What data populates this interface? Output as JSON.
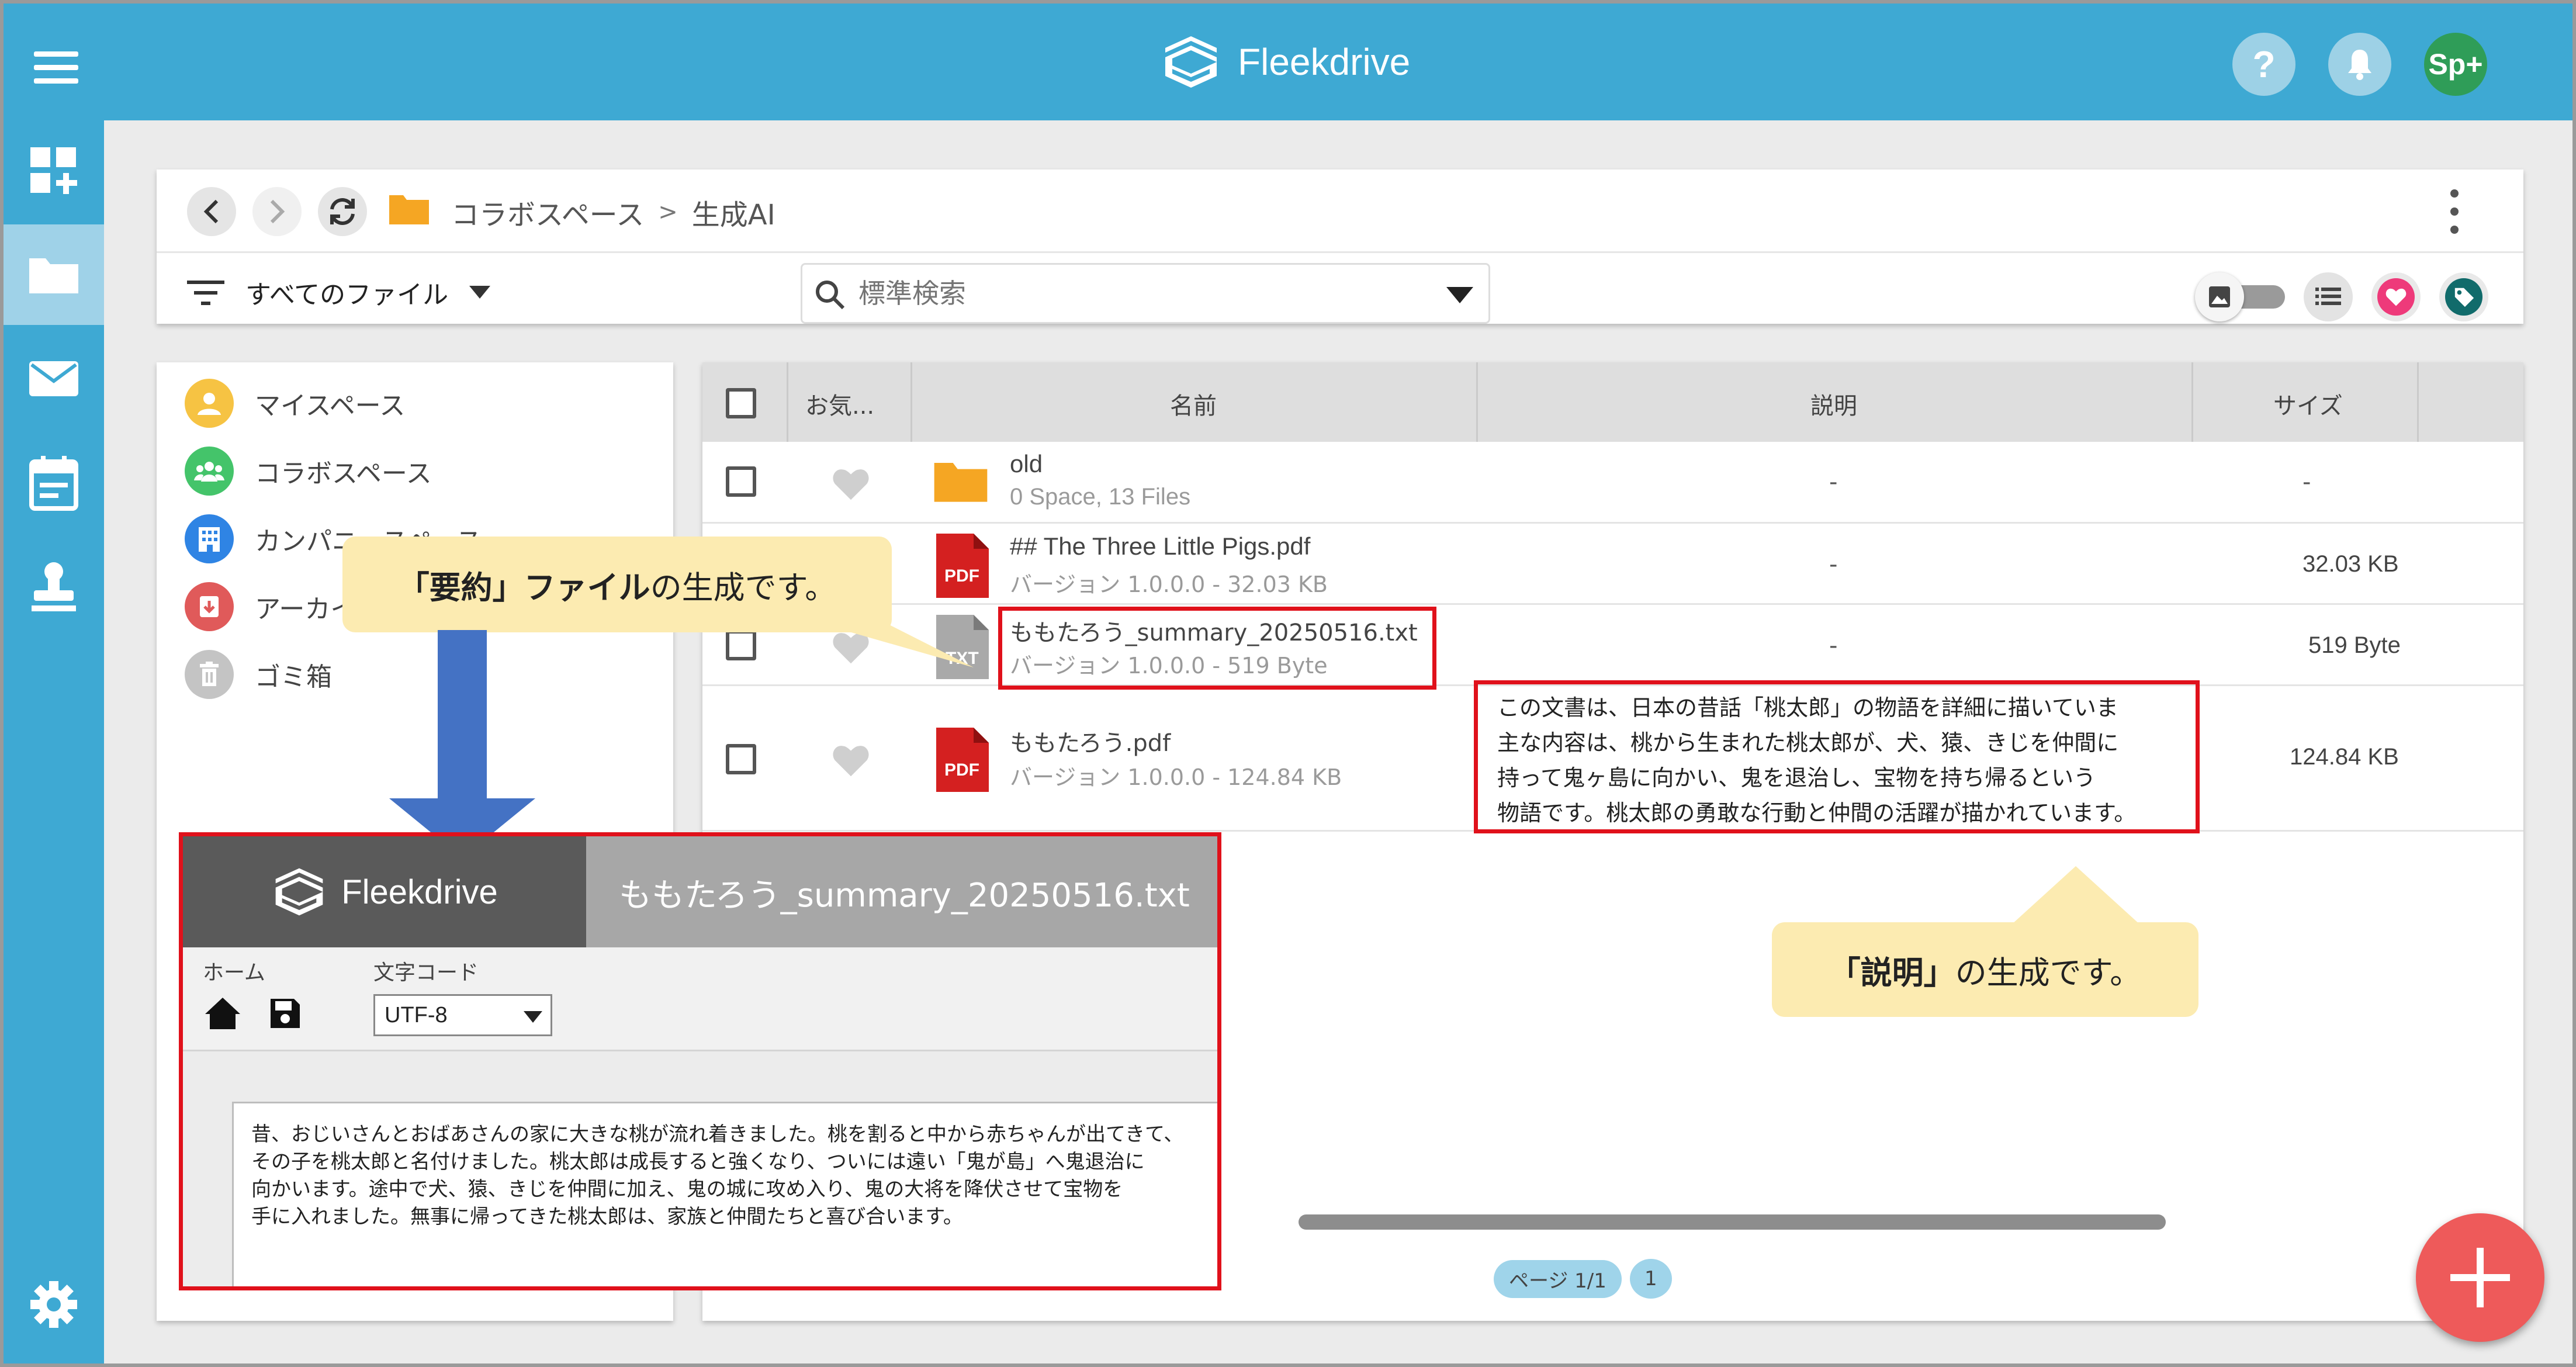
{
  "app": {
    "brand": "Fleekdrive",
    "user_initials": "Sp+"
  },
  "colors": {
    "topbar": "#3ea9d3",
    "accent_red": "#e0111b",
    "callout": "#fcebb1",
    "fab": "#ee5a5a"
  },
  "topbar": {
    "help_label": "?",
    "icons": [
      "menu-icon",
      "help-icon",
      "bell-icon",
      "user-avatar"
    ]
  },
  "sidenav": {
    "icons": [
      "dashboard-add-icon",
      "folder-icon",
      "mail-icon",
      "calendar-icon",
      "stamp-icon",
      "settings-icon"
    ]
  },
  "breadcrumb": {
    "root": "コラボスペース",
    "separator": ">",
    "current": "生成AI"
  },
  "filter": {
    "label": "すべてのファイル"
  },
  "search": {
    "placeholder": "標準検索"
  },
  "tree": {
    "items": [
      {
        "label": "マイスペース",
        "icon": "person-icon",
        "color": "#f6c343"
      },
      {
        "label": "コラボスペース",
        "icon": "group-icon",
        "color": "#44c46a"
      },
      {
        "label": "カンパニースペース",
        "icon": "building-icon",
        "color": "#2f84e4"
      },
      {
        "label": "アーカイブ",
        "icon": "archive-icon",
        "color": "#e05a5a"
      },
      {
        "label": "ゴミ箱",
        "icon": "trash-icon",
        "color": "#c4c4c4"
      }
    ]
  },
  "table": {
    "columns": [
      "お気...",
      "名前",
      "説明",
      "サイズ"
    ],
    "rows": [
      {
        "type": "folder",
        "name": "old",
        "meta": "0 Space, 13 Files",
        "description": "-",
        "size": "-"
      },
      {
        "type": "pdf",
        "name": "## The Three Little Pigs.pdf",
        "meta": "バージョン 1.0.0.0 - 32.03 KB",
        "description": "-",
        "size": "32.03 KB"
      },
      {
        "type": "txt",
        "name": "ももたろう_summary_20250516.txt",
        "meta": "バージョン 1.0.0.0 - 519 Byte",
        "description": "-",
        "size": "519 Byte"
      },
      {
        "type": "pdf",
        "name": "ももたろう.pdf",
        "meta": "バージョン 1.0.0.0 - 124.84 KB",
        "description": [
          "この文書は、日本の昔話「桃太郎」の物語を詳細に描いていま",
          "主な内容は、桃から生まれた桃太郎が、犬、猿、きじを仲間に",
          "持って鬼ヶ島に向かい、鬼を退治し、宝物を持ち帰るという",
          "物語です。桃太郎の勇敢な行動と仲間の活躍が描かれています。"
        ],
        "size": "124.84 KB"
      }
    ],
    "pdf_badge": "PDF",
    "txt_badge": "TXT"
  },
  "pager": {
    "label": "ページ 1/1",
    "page": "1"
  },
  "callouts": {
    "summary": {
      "bold": "「要約」ファイル",
      "rest": "の生成です。"
    },
    "description": {
      "bold": "「説明」",
      "rest": "の生成です。"
    }
  },
  "preview": {
    "brand": "Fleekdrive",
    "filename": "ももたろう_summary_20250516.txt",
    "home_label": "ホーム",
    "encoding_label": "文字コード",
    "encoding_value": "UTF-8",
    "text_lines": [
      "昔、おじいさんとおばあさんの家に大きな桃が流れ着きました。桃を割ると中から赤ちゃんが出てきて、",
      "その子を桃太郎と名付けました。桃太郎は成長すると強くなり、ついには遠い「鬼が島」へ鬼退治に",
      "向かいます。途中で犬、猿、きじを仲間に加え、鬼の城に攻め入り、鬼の大将を降伏させて宝物を",
      "手に入れました。無事に帰ってきた桃太郎は、家族と仲間たちと喜び合います。"
    ]
  },
  "fab": {
    "label": "+"
  }
}
